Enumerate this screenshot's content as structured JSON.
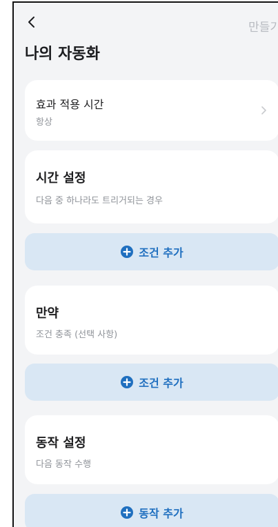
{
  "header": {
    "back_icon": "chevron-left-icon",
    "create_label": "만들기",
    "title": "나의 자동화"
  },
  "effective_time": {
    "label": "효과 적용 시간",
    "value": "항상",
    "chevron_icon": "chevron-right-icon"
  },
  "time_settings": {
    "title": "시간 설정",
    "subtitle": "다음 중 하나라도 트리거되는 경우",
    "add_label": "조건 추가"
  },
  "constraint": {
    "title": "만약",
    "subtitle": "조건 충족 (선택 사항)",
    "add_label": "조건 추가"
  },
  "action_settings": {
    "title": "동작 설정",
    "subtitle": "다음 동작 수행",
    "add_label": "동작 추가"
  },
  "colors": {
    "background": "#f3f4f6",
    "card": "#ffffff",
    "accent": "#1f6fbf",
    "button_bg": "#d9e7f4"
  }
}
